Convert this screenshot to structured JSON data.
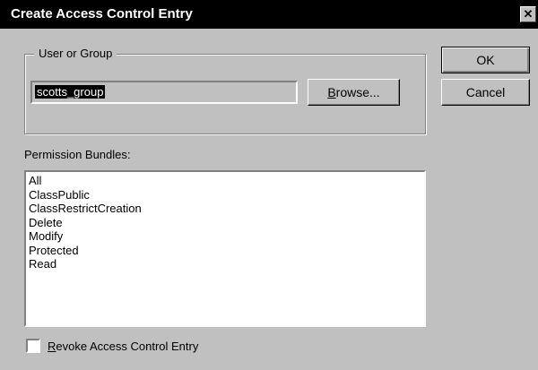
{
  "window": {
    "title": "Create Access Control Entry",
    "close_label": "✕"
  },
  "user_group": {
    "legend": "User or Group",
    "value": "scotts_group",
    "browse_label_prefix": "",
    "browse_label_underlined": "B",
    "browse_label_rest": "rowse..."
  },
  "buttons": {
    "ok_label": "OK",
    "cancel_label": "Cancel"
  },
  "permissions": {
    "label": "Permission Bundles:",
    "items": [
      "All",
      "ClassPublic",
      "ClassRestrictCreation",
      "Delete",
      "Modify",
      "Protected",
      "Read"
    ]
  },
  "revoke": {
    "checked": false,
    "label_underlined": "R",
    "label_rest": "evoke Access Control Entry"
  }
}
